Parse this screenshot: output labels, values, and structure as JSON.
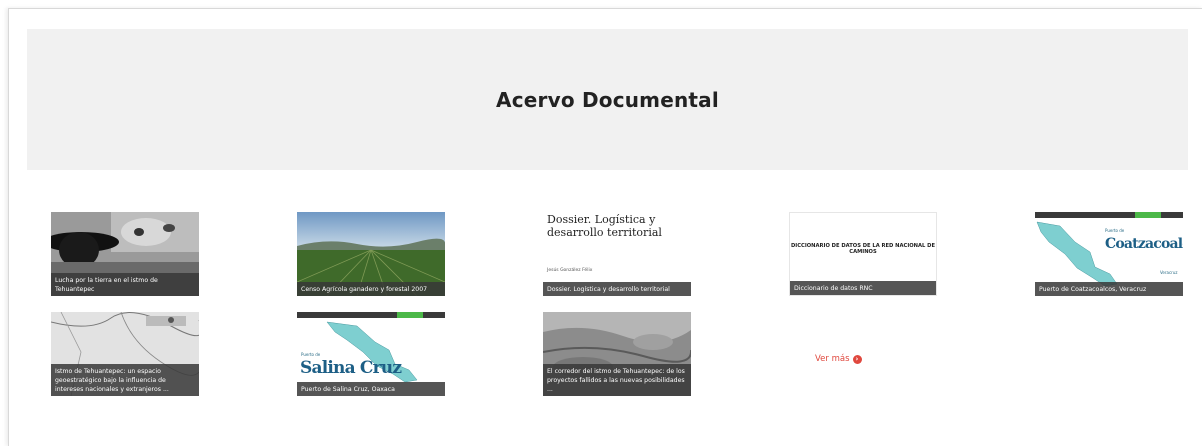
{
  "section": {
    "title": "Acervo Documental"
  },
  "cards": [
    {
      "caption": "Lucha por la tierra en el istmo de Tehuantepec"
    },
    {
      "caption": "Censo Agrícola ganadero y forestal 2007"
    },
    {
      "caption": "Dossier. Logística y desarrollo territorial",
      "thumb_title": "Dossier. Logística y desarrollo territorial",
      "thumb_author": "Jesús González Félix"
    },
    {
      "caption": "Diccionario de datos RNC",
      "thumb_text": "DICCIONARIO DE DATOS DE LA RED NACIONAL DE CAMINOS"
    },
    {
      "caption": "Puerto de Coatzacoalcos, Veracruz",
      "thumb_small": "Puerto de",
      "thumb_big": "Coatzacoalcos",
      "thumb_state": "Veracruz"
    },
    {
      "caption": "Istmo de Tehuantepec: un espacio geoestratégico bajo la influencia de intereses nacionales y extranjeros ..."
    },
    {
      "caption": "Puerto de Salina Cruz, Oaxaca",
      "thumb_small": "Puerto de",
      "thumb_big": "Salina Cruz"
    },
    {
      "caption": "El corredor del istmo de Tehuantepec: de los proyectos fallidos a las nuevas posibilidades ..."
    }
  ],
  "more_link": {
    "label": "Ver más",
    "icon": "arrow-right-circle-icon"
  },
  "colors": {
    "accent": "#e0483e",
    "banner_bg": "#f1f1f1",
    "caption_bg": "#373737",
    "map_green": "#4cb848",
    "map_sea": "#7ecfd0"
  }
}
